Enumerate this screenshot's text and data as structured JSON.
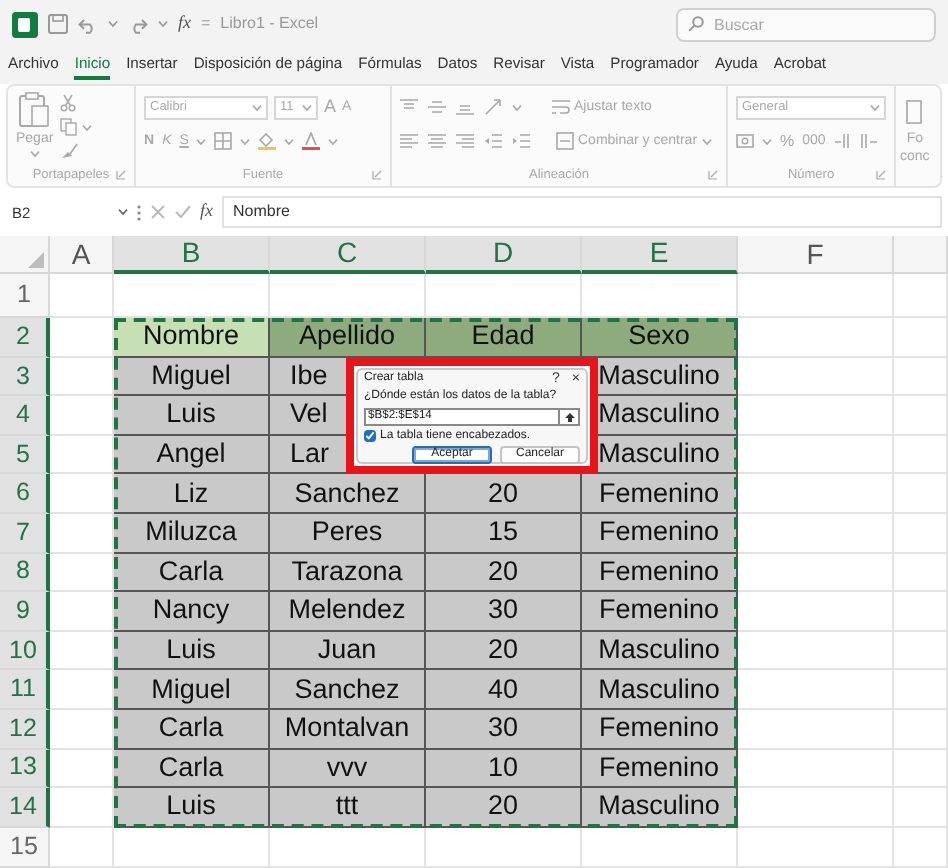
{
  "title_bar": {
    "quick_access": [
      "fx",
      "="
    ],
    "title": "Libro1 - Excel",
    "search": {
      "placeholder": "Buscar"
    }
  },
  "ribbon_tabs": [
    {
      "label": "Archivo",
      "selected": false
    },
    {
      "label": "Inicio",
      "selected": true
    },
    {
      "label": "Insertar",
      "selected": false
    },
    {
      "label": "Disposición de página",
      "selected": false
    },
    {
      "label": "Fórmulas",
      "selected": false
    },
    {
      "label": "Datos",
      "selected": false
    },
    {
      "label": "Revisar",
      "selected": false
    },
    {
      "label": "Vista",
      "selected": false
    },
    {
      "label": "Programador",
      "selected": false
    },
    {
      "label": "Ayuda",
      "selected": false
    },
    {
      "label": "Acrobat",
      "selected": false
    }
  ],
  "ribbon": {
    "disabled": true,
    "groups": [
      {
        "kind": "clipboard",
        "label": "Portapapeles",
        "paste": "Pegar"
      },
      {
        "kind": "font",
        "label": "Fuente",
        "font": "Calibri",
        "size": "11",
        "grow": "A",
        "shrink": "A",
        "bold": "N",
        "italic": "K",
        "underline": "S"
      },
      {
        "kind": "alignment",
        "label": "Alineación",
        "wrap": "Ajustar texto",
        "merge": "Combinar y centrar"
      },
      {
        "kind": "number",
        "label": "Número",
        "format": "General",
        "percent": "%",
        "thousands": "000"
      },
      {
        "kind": "partial",
        "lines": [
          "Fo",
          "conc"
        ]
      }
    ]
  },
  "formula_bar": {
    "name_box": "B2",
    "fx": "fx",
    "value": "Nombre"
  },
  "sheet": {
    "columns": [
      {
        "label": "A",
        "selected": false
      },
      {
        "label": "B",
        "selected": true
      },
      {
        "label": "C",
        "selected": true
      },
      {
        "label": "D",
        "selected": true
      },
      {
        "label": "E",
        "selected": true
      },
      {
        "label": "F",
        "selected": false
      }
    ],
    "row_numbers": [
      {
        "label": "1",
        "selected": false
      },
      {
        "label": "2",
        "selected": true
      },
      {
        "label": "3",
        "selected": true
      },
      {
        "label": "4",
        "selected": true
      },
      {
        "label": "5",
        "selected": true
      },
      {
        "label": "6",
        "selected": true
      },
      {
        "label": "7",
        "selected": true
      },
      {
        "label": "8",
        "selected": true
      },
      {
        "label": "9",
        "selected": true
      },
      {
        "label": "10",
        "selected": true
      },
      {
        "label": "11",
        "selected": true
      },
      {
        "label": "12",
        "selected": true
      },
      {
        "label": "13",
        "selected": true
      },
      {
        "label": "14",
        "selected": true
      },
      {
        "label": "15",
        "selected": false
      }
    ],
    "table": {
      "header": [
        {
          "text": "Nombre",
          "selected": true
        },
        {
          "text": "Apellido",
          "selected": false
        },
        {
          "text": "Edad",
          "selected": false
        },
        {
          "text": "Sexo",
          "selected": false
        }
      ],
      "rows": [
        [
          "Miguel",
          {
            "text": "Ibe",
            "cut": true
          },
          null,
          "Masculino"
        ],
        [
          "Luis",
          {
            "text": "Vel",
            "cut": true
          },
          null,
          "Masculino"
        ],
        [
          "Angel",
          {
            "text": "Lar",
            "cut": true
          },
          null,
          "Masculino"
        ],
        [
          "Liz",
          "Sanchez",
          "20",
          "Femenino"
        ],
        [
          "Miluzca",
          "Peres",
          "15",
          "Femenino"
        ],
        [
          "Carla",
          "Tarazona",
          "20",
          "Femenino"
        ],
        [
          "Nancy",
          "Melendez",
          "30",
          "Femenino"
        ],
        [
          "Luis",
          "Juan",
          "20",
          "Masculino"
        ],
        [
          "Miguel",
          "Sanchez",
          "40",
          "Masculino"
        ],
        [
          "Carla",
          "Montalvan",
          "30",
          "Femenino"
        ],
        [
          "Carla",
          "vvv",
          "10",
          "Femenino"
        ],
        [
          "Luis",
          "ttt",
          "20",
          "Masculino"
        ]
      ]
    }
  },
  "dialog": {
    "title": "Crear tabla",
    "help": "?",
    "close": "×",
    "prompt": "¿Dónde están los datos de la tabla?",
    "range": "$B$2:$E$14",
    "headers_checkbox": {
      "label": "La tabla tiene encabezados.",
      "checked": true
    },
    "buttons": [
      {
        "label": "Aceptar",
        "default": true
      },
      {
        "label": "Cancelar",
        "default": false
      }
    ]
  }
}
